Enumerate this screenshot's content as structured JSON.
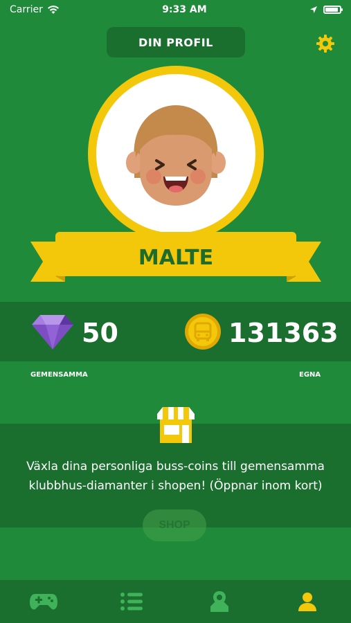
{
  "status_bar": {
    "carrier": "Carrier",
    "time": "9:33 AM",
    "wifi_icon": "wifi-icon",
    "location_icon": "location-arrow-icon",
    "battery_icon": "battery-icon"
  },
  "header": {
    "title": "DIN PROFIL",
    "settings_icon": "gear-icon"
  },
  "profile": {
    "name": "MALTE",
    "avatar": "smiling-child-avatar"
  },
  "stats": {
    "shared": {
      "icon": "diamond-icon",
      "value": "50",
      "label": "GEMENSAMMA"
    },
    "own": {
      "icon": "bus-coin-icon",
      "value": "131363",
      "label": "EGNA"
    }
  },
  "shop": {
    "icon": "shop-icon",
    "description": "Växla dina personliga buss-coins till gemensamma klubbhus-diamanter i shopen! (Öppnar inom kort)",
    "button_label": "SHOP"
  },
  "bottom_nav": [
    {
      "name": "games",
      "icon": "gamepad-icon",
      "active": false
    },
    {
      "name": "list",
      "icon": "list-icon",
      "active": false
    },
    {
      "name": "map",
      "icon": "map-pin-icon",
      "active": false
    },
    {
      "name": "profile",
      "icon": "user-icon",
      "active": true
    }
  ],
  "colors": {
    "background": "#1f8a3a",
    "band": "#1a6f2f",
    "accent": "#f4c80a",
    "name_text": "#1f6b2a",
    "nav_inactive": "#3fb25a",
    "nav_active": "#f4c80a"
  }
}
